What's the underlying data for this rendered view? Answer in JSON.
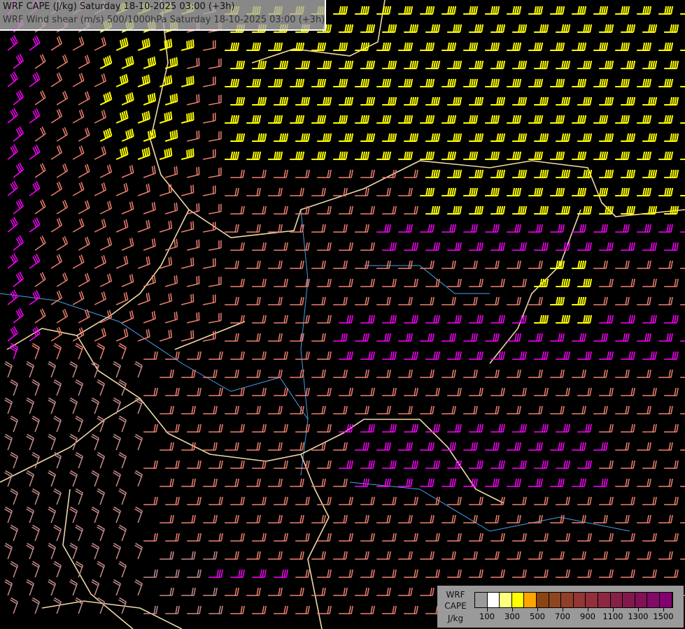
{
  "title": {
    "line1": "WRF CAPE (J/kg) Saturday 18-10-2025 03:00 (+3h)",
    "line2": "WRF Wind shear (m/s) 500/1000hPa Saturday 18-10-2025 03:00 (+3h)"
  },
  "legend": {
    "label1": "WRF",
    "label2": "CAPE",
    "label3": "J/kg",
    "colors": [
      "#9a9a9a",
      "#ffffff",
      "#ffff80",
      "#ffff00",
      "#ffa500",
      "#8b4513",
      "#8e4420",
      "#913f2a",
      "#923733",
      "#90303a",
      "#8b2840",
      "#862045",
      "#82194c",
      "#7f1356",
      "#800a66",
      "#83006f"
    ],
    "ticks": [
      "100",
      "300",
      "500",
      "700",
      "900",
      "1100",
      "1300",
      "1500"
    ]
  },
  "shear_colors": {
    "high": "#ffff00",
    "strong": "#ff00ff",
    "moderate": "#f08070",
    "weak": "#c88c8c",
    "border": "#f0d8a8",
    "river": "#4aa0e8"
  }
}
